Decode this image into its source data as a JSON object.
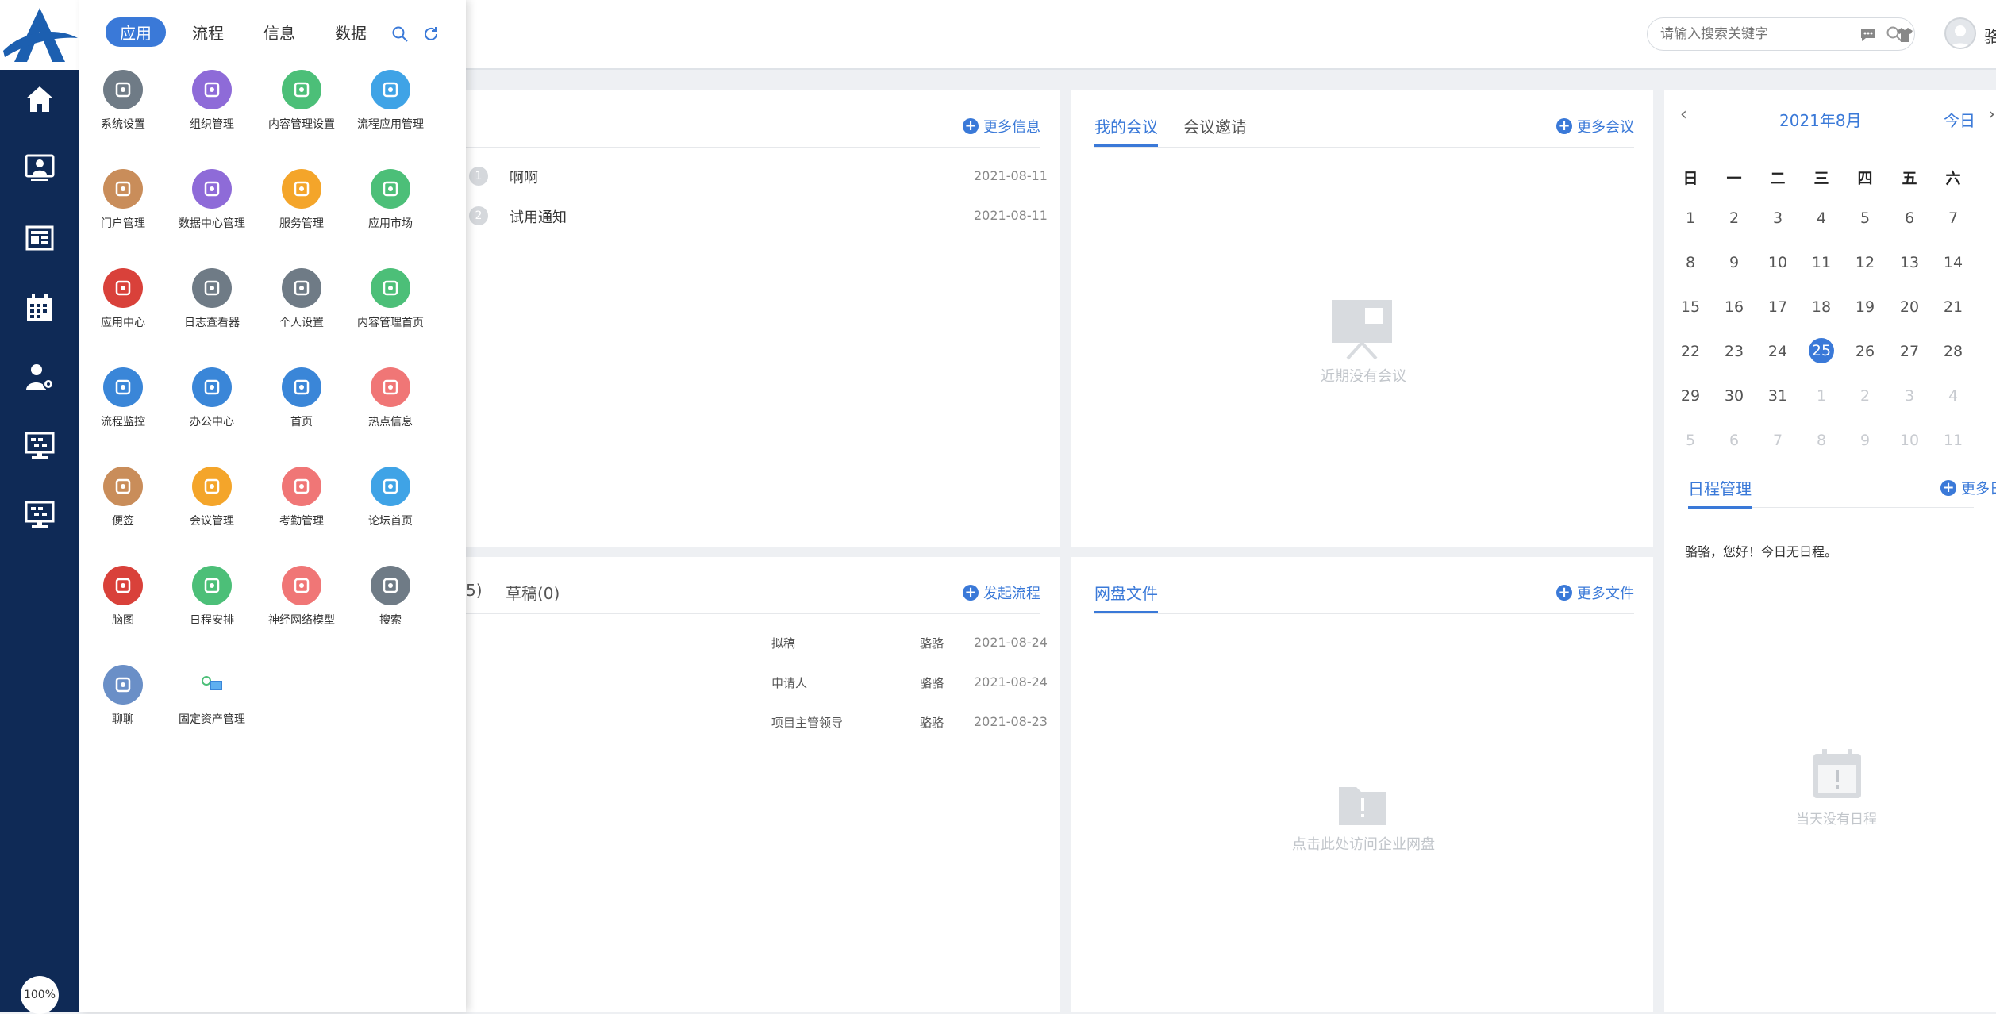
{
  "header": {
    "search_placeholder": "请输入搜索关键字",
    "user_name": "骆"
  },
  "sidebar": {
    "zoom_level": "100%",
    "items": [
      "home-icon",
      "user-screen-icon",
      "newspaper-icon",
      "calendar-icon",
      "user-settings-icon",
      "monitor-chart-icon",
      "monitor-chart-icon"
    ]
  },
  "drawer": {
    "tabs": [
      "应用",
      "流程",
      "信息",
      "数据"
    ],
    "apps": [
      {
        "label": "系统设置",
        "icon": "gear-icon",
        "color": "#6f7b86"
      },
      {
        "label": "组织管理",
        "icon": "org-icon",
        "color": "#8e6bd8"
      },
      {
        "label": "内容管理设置",
        "icon": "monitor-icon",
        "color": "#4cbf78"
      },
      {
        "label": "流程应用管理",
        "icon": "flow-monitor-icon",
        "color": "#3fa3e6"
      },
      {
        "label": "门户管理",
        "icon": "grid-icon",
        "color": "#c98d5a"
      },
      {
        "label": "数据中心管理",
        "icon": "chart-icon",
        "color": "#8e6bd8"
      },
      {
        "label": "服务管理",
        "icon": "service-icon",
        "color": "#f4a52a"
      },
      {
        "label": "应用市场",
        "icon": "bag-icon",
        "color": "#4cbf78"
      },
      {
        "label": "应用中心",
        "icon": "share-icon",
        "color": "#d9413a"
      },
      {
        "label": "日志查看器",
        "icon": "log-icon",
        "color": "#6f7b86"
      },
      {
        "label": "个人设置",
        "icon": "user-gear-icon",
        "color": "#6f7b86"
      },
      {
        "label": "内容管理首页",
        "icon": "content-icon",
        "color": "#4cbf78"
      },
      {
        "label": "流程监控",
        "icon": "gauge-icon",
        "color": "#3a86d8"
      },
      {
        "label": "办公中心",
        "icon": "office-icon",
        "color": "#3a86d8"
      },
      {
        "label": "首页",
        "icon": "home-icon",
        "color": "#3a86d8"
      },
      {
        "label": "热点信息",
        "icon": "fire-icon",
        "color": "#f07676"
      },
      {
        "label": "便签",
        "icon": "note-icon",
        "color": "#c98d5a"
      },
      {
        "label": "会议管理",
        "icon": "meeting-icon",
        "color": "#f4a52a"
      },
      {
        "label": "考勤管理",
        "icon": "hand-icon",
        "color": "#f07676"
      },
      {
        "label": "论坛首页",
        "icon": "forum-icon",
        "color": "#3fa3e6"
      },
      {
        "label": "脑图",
        "icon": "mindmap-icon",
        "color": "#d9413a"
      },
      {
        "label": "日程安排",
        "icon": "schedule-icon",
        "color": "#4cbf78"
      },
      {
        "label": "神经网络模型",
        "icon": "brain-icon",
        "color": "#f07676"
      },
      {
        "label": "搜索",
        "icon": "search-icon",
        "color": "#6f7b86"
      },
      {
        "label": "聊聊",
        "icon": "chat-icon",
        "color": "#6a8fc7"
      },
      {
        "label": "固定资产管理",
        "icon": "asset-icon",
        "color": "#ffffff"
      }
    ]
  },
  "notices": {
    "more": "更多信息",
    "items": [
      {
        "num": "1",
        "title": "啊啊",
        "date": "2021-08-11"
      },
      {
        "num": "2",
        "title": "试用通知",
        "date": "2021-08-11"
      }
    ]
  },
  "meetings": {
    "tabs": [
      "我的会议",
      "会议邀请"
    ],
    "more": "更多会议",
    "empty": "近期没有会议"
  },
  "calendar": {
    "month": "2021年8月",
    "today_label": "今日",
    "weekdays": [
      "日",
      "一",
      "二",
      "三",
      "四",
      "五",
      "六"
    ],
    "today": "25",
    "days": [
      [
        "1",
        "2",
        "3",
        "4",
        "5",
        "6",
        "7"
      ],
      [
        "8",
        "9",
        "10",
        "11",
        "12",
        "13",
        "14"
      ],
      [
        "15",
        "16",
        "17",
        "18",
        "19",
        "20",
        "21"
      ],
      [
        "22",
        "23",
        "24",
        "25",
        "26",
        "27",
        "28"
      ],
      [
        "29",
        "30",
        "31",
        "1",
        "2",
        "3",
        "4"
      ],
      [
        "5",
        "6",
        "7",
        "8",
        "9",
        "10",
        "11"
      ]
    ],
    "schedule_tab": "日程管理",
    "more": "更多日程",
    "greeting": "骆骆，您好！今日无日程。",
    "empty": "当天没有日程"
  },
  "flow": {
    "partial_tab": "5)",
    "draft_tab": "草稿(0)",
    "start": "发起流程",
    "items": [
      {
        "step": "拟稿",
        "user": "骆骆",
        "date": "2021-08-24"
      },
      {
        "step": "申请人",
        "user": "骆骆",
        "date": "2021-08-24"
      },
      {
        "step": "项目主管领导",
        "user": "骆骆",
        "date": "2021-08-23"
      }
    ]
  },
  "files": {
    "tab": "网盘文件",
    "more": "更多文件",
    "empty": "点击此处访问企业网盘"
  }
}
